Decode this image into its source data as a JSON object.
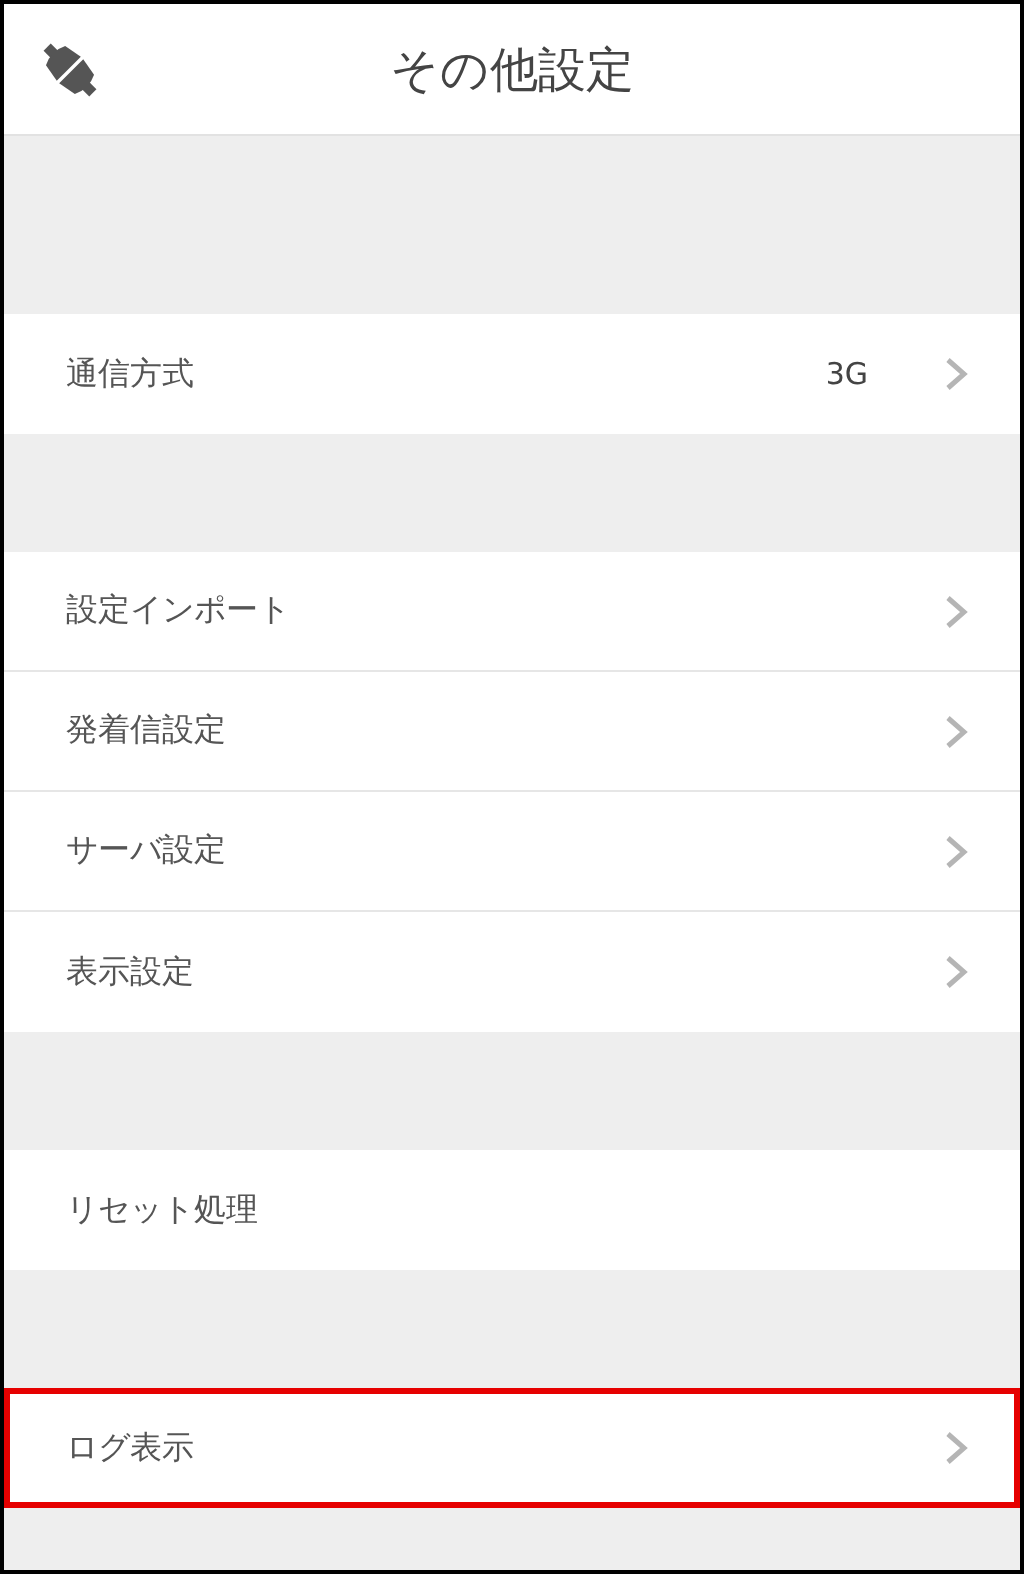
{
  "header": {
    "title": "その他設定"
  },
  "groups": [
    {
      "rows": [
        {
          "label": "通信方式",
          "value": "3G",
          "chevron": true,
          "highlighted": false
        }
      ]
    },
    {
      "rows": [
        {
          "label": "設定インポート",
          "chevron": true,
          "highlighted": false
        },
        {
          "label": "発着信設定",
          "chevron": true,
          "highlighted": false
        },
        {
          "label": "サーバ設定",
          "chevron": true,
          "highlighted": false
        },
        {
          "label": "表示設定",
          "chevron": true,
          "highlighted": false
        }
      ]
    },
    {
      "rows": [
        {
          "label": "リセット処理",
          "chevron": false,
          "highlighted": false
        }
      ]
    },
    {
      "rows": [
        {
          "label": "ログ表示",
          "chevron": true,
          "highlighted": true
        }
      ]
    }
  ]
}
